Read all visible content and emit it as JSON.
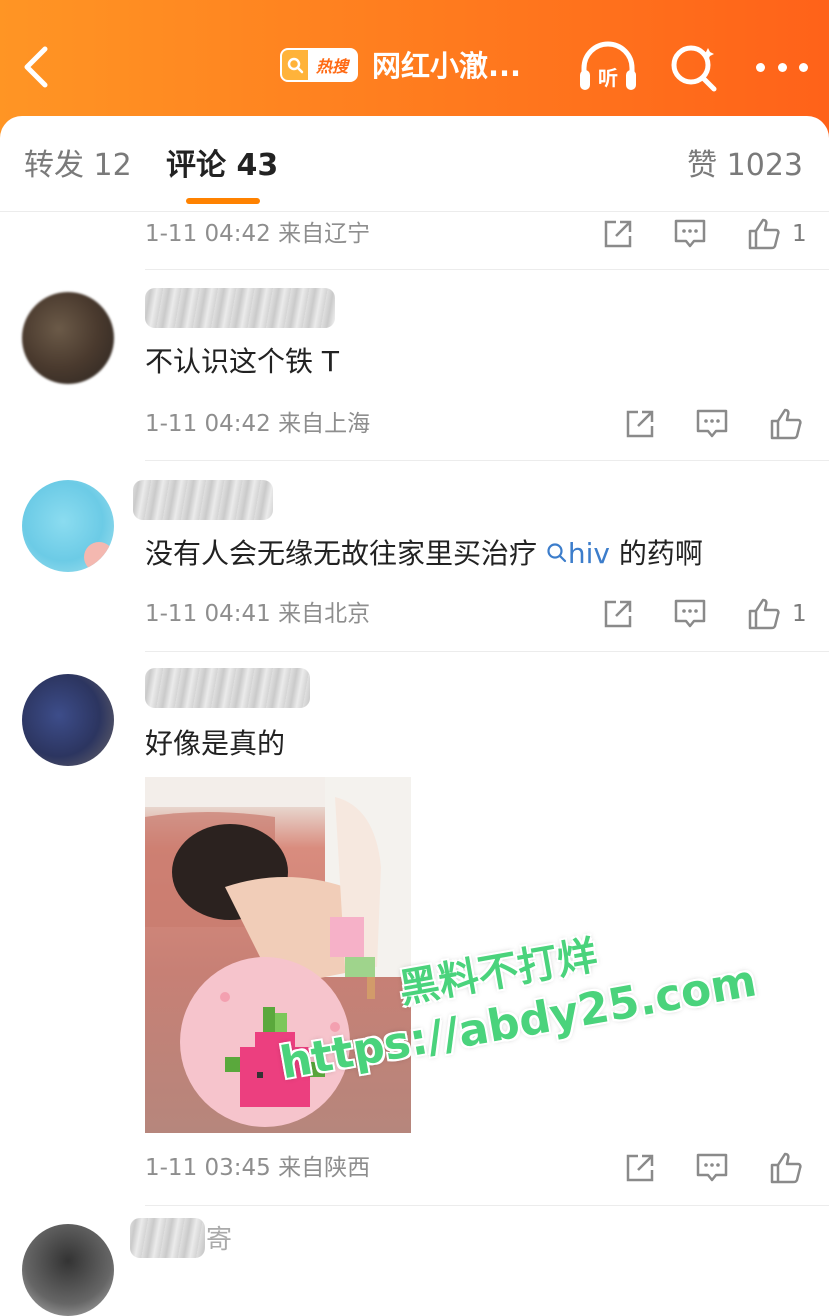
{
  "header": {
    "hot_badge": "热搜",
    "title": "网红小澈...",
    "listen_label": "听",
    "accent_color": "#ff7a1e"
  },
  "tabs": {
    "repost": "转发 12",
    "comments": "评论 43",
    "likes": "赞 1023",
    "indicator_color": "#ff8200"
  },
  "comments": [
    {
      "name": "",
      "text": "",
      "meta": "1-11 04:42  来自辽宁",
      "like_count": "1"
    },
    {
      "name": "",
      "text": "不认识这个铁 T",
      "meta": "1-11 04:42  来自上海",
      "like_count": ""
    },
    {
      "name": "",
      "text_before": "没有人会无缘无故往家里买治疗 ",
      "topic": "hiv",
      "text_after": " 的药啊",
      "meta": "1-11 04:41  来自北京",
      "like_count": "1"
    },
    {
      "name": "",
      "text": "好像是真的",
      "meta": "1-11 03:45  来自陕西",
      "like_count": "",
      "has_image": true
    },
    {
      "name_partial": "寄"
    }
  ],
  "watermark": {
    "line1": "黑料不打烊",
    "line2": "https://abdy25.com"
  },
  "icons": {
    "back": "chevron-left-icon",
    "listen": "headphones-icon",
    "search": "search-icon",
    "more": "more-icon",
    "share": "share-icon",
    "comment": "comment-icon",
    "like": "thumbs-up-icon",
    "topic": "search-icon"
  }
}
